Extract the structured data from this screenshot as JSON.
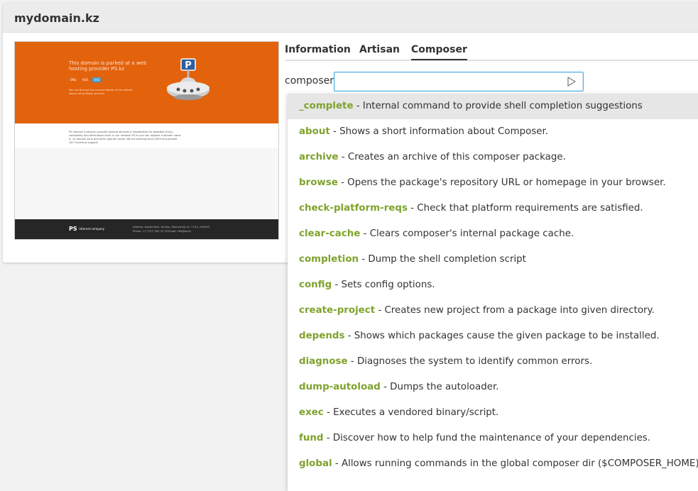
{
  "card": {
    "title": "mydomain.kz"
  },
  "preview": {
    "headline": "This domain is parked at a web hosting provider PS.kz",
    "langs": [
      "ENG",
      "RUS",
      "KAZ"
    ],
    "small_text": "You can find out the contact details of the domain owner using Whois services.",
    "mid_text": "PS Internet Company provides hosting services in Kazakhstan for websites of any complexity and attendance level. In our network PS kz you can register a domain name in .kz domain zone and other popular zones. We are working since 2009 and provide 24/7 technical support.",
    "footer_logo": "PS",
    "footer_logo_sub": "Internet company",
    "footer_addr1": "Address: Kazakhstan, Almaty, Mamyshuly st. 77/1a, 050043",
    "footer_addr2": "Phone: +7 (727) 355 33 33  Email: info@ps.kz"
  },
  "tabs": [
    {
      "label": "Information"
    },
    {
      "label": "Artisan"
    },
    {
      "label": "Composer"
    }
  ],
  "active_tab": "Composer",
  "composer": {
    "label": "composer",
    "value": "",
    "run_icon": "play-triangle-icon"
  },
  "suggestions": [
    {
      "cmd": "_complete",
      "desc": " - Internal command to provide shell completion suggestions"
    },
    {
      "cmd": "about",
      "desc": " - Shows a short information about Composer."
    },
    {
      "cmd": "archive",
      "desc": " - Creates an archive of this composer package."
    },
    {
      "cmd": "browse",
      "desc": " - Opens the package's repository URL or homepage in your browser."
    },
    {
      "cmd": "check-platform-reqs",
      "desc": " - Check that platform requirements are satisfied."
    },
    {
      "cmd": "clear-cache",
      "desc": " - Clears composer's internal package cache."
    },
    {
      "cmd": "completion",
      "desc": " - Dump the shell completion script"
    },
    {
      "cmd": "config",
      "desc": " - Sets config options."
    },
    {
      "cmd": "create-project",
      "desc": " - Creates new project from a package into given directory."
    },
    {
      "cmd": "depends",
      "desc": " - Shows which packages cause the given package to be installed."
    },
    {
      "cmd": "diagnose",
      "desc": " - Diagnoses the system to identify common errors."
    },
    {
      "cmd": "dump-autoload",
      "desc": " - Dumps the autoloader."
    },
    {
      "cmd": "exec",
      "desc": " - Executes a vendored binary/script."
    },
    {
      "cmd": "fund",
      "desc": " - Discover how to help fund the maintenance of your dependencies."
    },
    {
      "cmd": "global",
      "desc": " - Allows running commands in the global composer dir ($COMPOSER_HOME)."
    }
  ],
  "colors": {
    "command_accent": "#7fa32c",
    "preview_orange": "#e3620c",
    "input_focus": "#55b0e8"
  }
}
